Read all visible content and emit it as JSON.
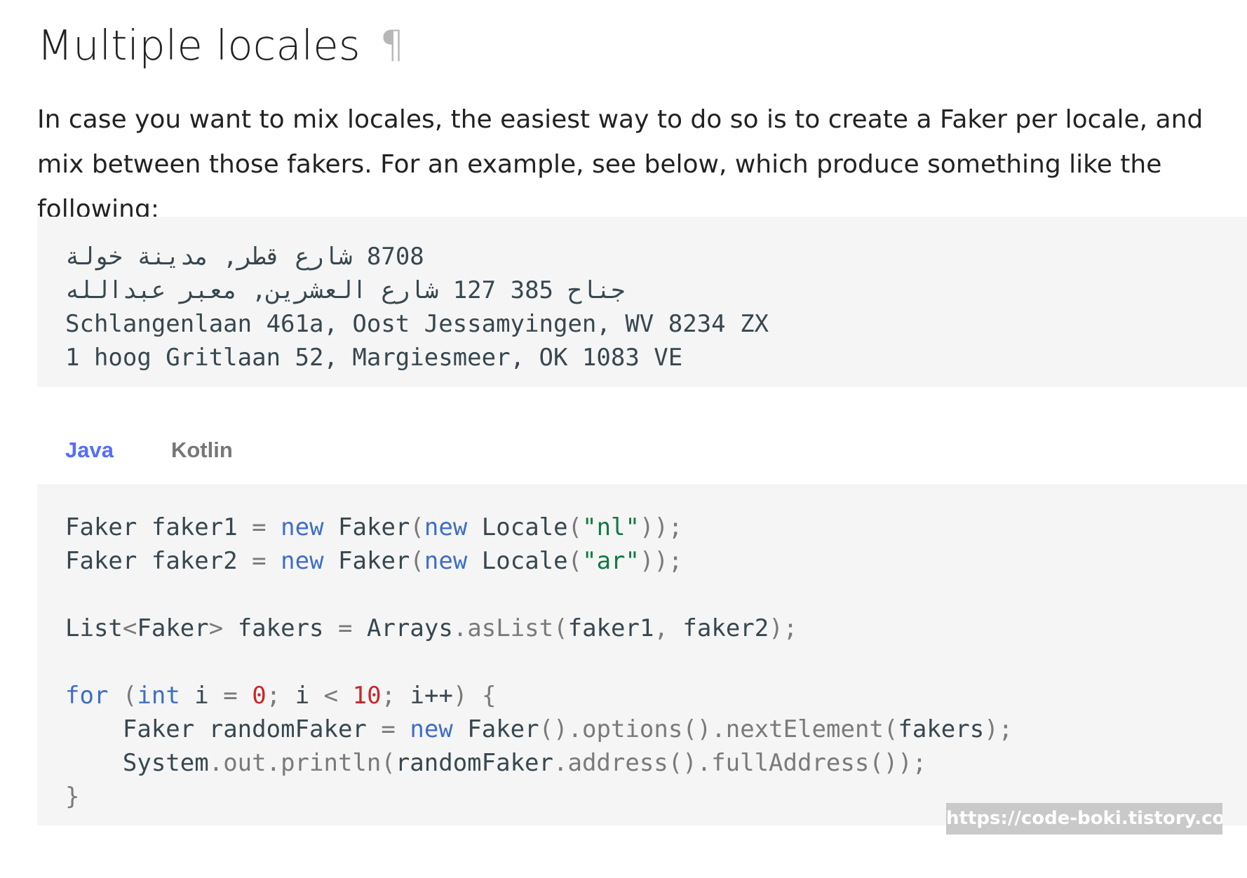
{
  "heading": {
    "title": "Multiple locales",
    "permalink": "¶"
  },
  "paragraph": "In case you want to mix locales, the easiest way to do so is to create a Faker per locale, and mix between those fakers. For an example, see below, which produce something like the following:",
  "output": {
    "lines": [
      "8708 شارع قطر, مدينة خولة",
      "جناح 385 127 شارع العشرين, معبر عبدالله",
      "Schlangenlaan 461a, Oost Jessamyingen, WV 8234 ZX",
      "1 hoog Gritlaan 52, Margiesmeer, OK 1083 VE"
    ]
  },
  "tabs": [
    {
      "label": "Java",
      "active": true
    },
    {
      "label": "Kotlin",
      "active": false
    }
  ],
  "code": {
    "line1": {
      "type": "Faker",
      "var": "faker1",
      "eq": "=",
      "new1": "new",
      "cls": "Faker",
      "p1": "(",
      "new2": "new",
      "locale": "Locale",
      "p2": "(",
      "str": "\"nl\"",
      "end": "));"
    },
    "line2": {
      "type": "Faker",
      "var": "faker2",
      "eq": "=",
      "new1": "new",
      "cls": "Faker",
      "p1": "(",
      "new2": "new",
      "locale": "Locale",
      "p2": "(",
      "str": "\"ar\"",
      "end": "));"
    },
    "line3": {
      "type": "List",
      "lt": "<",
      "generic": "Faker",
      "gt": ">",
      "var": "fakers",
      "eq": "=",
      "obj": "Arrays",
      "dot": ".",
      "method": "asList",
      "p1": "(",
      "arg1": "faker1",
      "comma": ",",
      "arg2": "faker2",
      "end": ");"
    },
    "line4": {
      "kw": "for",
      "p1": "(",
      "int": "int",
      "i": "i",
      "eq": "=",
      "zero": "0",
      "semi1": ";",
      "i2": "i",
      "lt": "<",
      "ten": "10",
      "semi2": ";",
      "inc": "i++",
      "p2": ")",
      "brace": "{"
    },
    "line5": {
      "type": "Faker",
      "var": "randomFaker",
      "eq": "=",
      "new": "new",
      "cls": "Faker",
      "c1": "().options().nextElement(",
      "arg": "fakers",
      "end": ");"
    },
    "line6": {
      "obj": "System",
      "c1": ".out.println(",
      "arg": "randomFaker",
      "c2": ".address().fullAddress());"
    },
    "line7": {
      "brace": "}"
    }
  },
  "watermark": "https://code-boki.tistory.com"
}
